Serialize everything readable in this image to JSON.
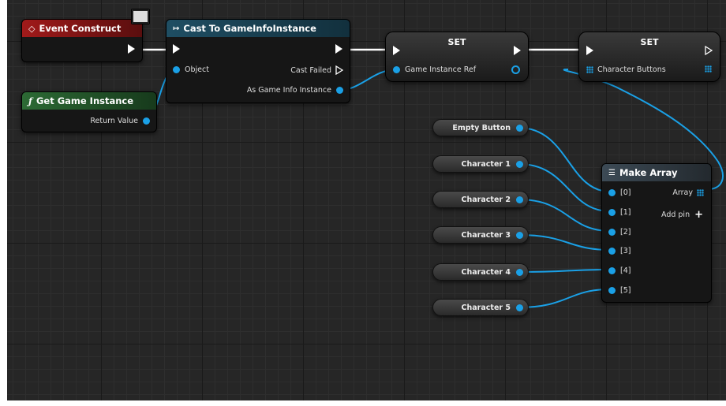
{
  "nodes": {
    "event_construct": {
      "title": "Event Construct"
    },
    "cast": {
      "title": "Cast To GameInfoInstance",
      "object_label": "Object",
      "cast_failed_label": "Cast Failed",
      "as_label": "As Game Info Instance"
    },
    "get_game_instance": {
      "title": "Get Game Instance",
      "return_label": "Return Value"
    },
    "set1": {
      "title": "SET",
      "pin_label": "Game Instance Ref"
    },
    "set2": {
      "title": "SET",
      "pin_label": "Character Buttons"
    },
    "make_array": {
      "title": "Make Array",
      "array_label": "Array",
      "add_pin_label": "Add pin",
      "inputs": [
        "[0]",
        "[1]",
        "[2]",
        "[3]",
        "[4]",
        "[5]"
      ]
    }
  },
  "variables": [
    "Empty Button",
    "Character 1",
    "Character 2",
    "Character 3",
    "Character 4",
    "Character 5"
  ],
  "colors": {
    "event_header": "#8a1414",
    "function_header": "#1f4a25",
    "cast_header": "#1b3a4a",
    "wire_blue": "#1aa0e6",
    "wire_exec": "#ffffff"
  }
}
